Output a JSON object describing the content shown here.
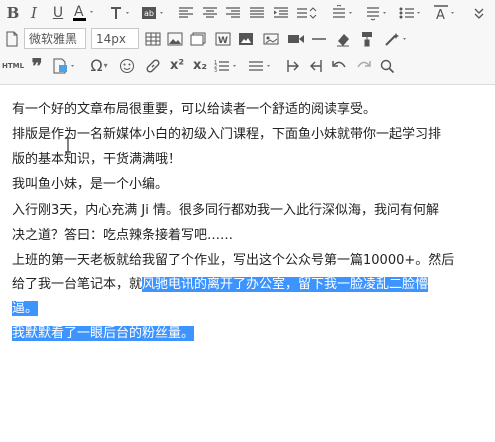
{
  "toolbar": {
    "font_family_value": "微软雅黑",
    "font_size_value": "14px",
    "html_label": "HTML",
    "colors": {
      "icon": "#555555",
      "text_color_bar": "#000000",
      "highlight": "#3e94ff"
    }
  },
  "content": {
    "lines": [
      "有一个好的文章布局很重要，可以给读者一个舒适的阅读享受。",
      "排版是作为一名新媒体小白的初级入门课程，下面鱼小妹就带你一起学习排",
      "版的基本知识，干货满满哦！",
      "我叫鱼小妹，是一个小编。",
      "入行刚3天，内心充满 Ji 情。很多同行都劝我一入此行深似海，我问有何解",
      "决之道？答曰：吃点辣条接着写吧……",
      "上班的第一天老板就给我留了个作业，写出这个公众号第一篇10000+。然后",
      "给了我一台笔记本，就",
      "风驰电讯的离开了办公室，留下我一脸凌乱二脸懵",
      "逼。",
      "我默默看了一眼后台的粉丝量。"
    ]
  }
}
